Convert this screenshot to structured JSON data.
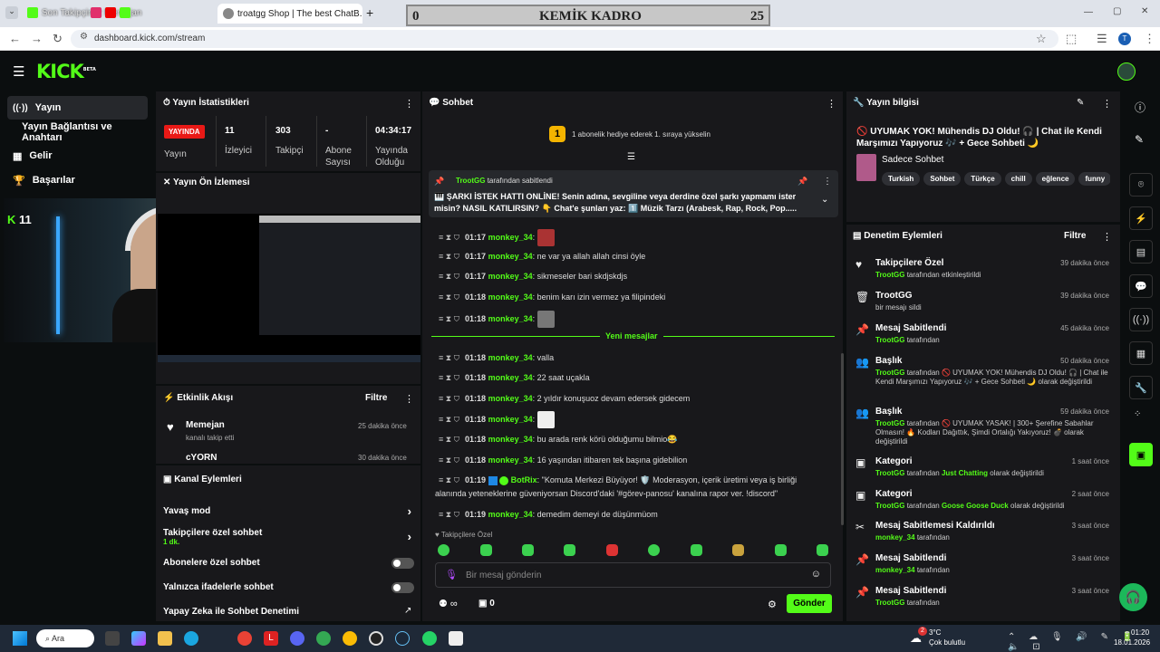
{
  "browser": {
    "tabs": [
      {
        "label": "Son Takipçimiz Memejan",
        "color": "#53fc18"
      },
      {
        "label": "troatgg Shop | The best ChatB...",
        "color": "#888"
      }
    ],
    "new_tab": "+",
    "url": "dashboard.kick.com/stream"
  },
  "scoreboard": {
    "left": "0",
    "title": "KEMİK KADRO",
    "right": "25"
  },
  "kick": {
    "logo": "KICK",
    "beta": "BETA"
  },
  "sidebar": {
    "items": [
      {
        "label": "Yayın",
        "icon": "broadcast-icon"
      },
      {
        "label": "Yayın Bağlantısı ve Anahtarı",
        "icon": ""
      },
      {
        "label": "Gelir",
        "icon": "revenue-icon"
      },
      {
        "label": "Başarılar",
        "icon": "trophy-icon"
      }
    ],
    "overlay_count": "11"
  },
  "stats": {
    "title": "Yayın İstatistikleri",
    "live": "YAYINDA",
    "live_label": "Yayın",
    "items": [
      {
        "value": "11",
        "label": "İzleyici"
      },
      {
        "value": "303",
        "label": "Takipçi"
      },
      {
        "value": "-",
        "label": "Abone Sayısı"
      },
      {
        "value": "04:34:17",
        "label": "Yayında Olduğu"
      }
    ]
  },
  "preview": {
    "title": "Yayın Ön İzlemesi"
  },
  "activity": {
    "title": "Etkinlik Akışı",
    "filter": "Filtre",
    "items": [
      {
        "name": "Memejan",
        "desc": "kanalı takip etti",
        "time": "25 dakika önce"
      },
      {
        "name": "cYORN",
        "desc": "",
        "time": "30 dakika önce"
      }
    ]
  },
  "channel_actions": {
    "title": "Kanal Eylemleri",
    "items": [
      {
        "label": "Yavaş mod",
        "sub": ""
      },
      {
        "label": "Takipçilere özel sohbet",
        "sub": "1 dk."
      },
      {
        "label": "Abonelere özel sohbet",
        "sub": ""
      },
      {
        "label": "Yalnızca ifadelerle sohbet",
        "sub": ""
      },
      {
        "label": "Yapay Zeka ile Sohbet Denetimi",
        "sub": ""
      }
    ]
  },
  "chat": {
    "title": "Sohbet",
    "gift_banner": "1 abonelik hediye ederek 1. sıraya yükselin",
    "gift_rank": "1",
    "pinned": {
      "by": "TrootGG",
      "by_suffix": "tarafından sabitlendi",
      "text": "🎹 ŞARKI İSTEK HATTI ONLİNE! Senin adına, sevgiline veya derdine özel şarkı yapmamı ister misin? NASIL KATILIRSIN? 👇 Chat'e şunları yaz: 1️⃣ Müzik Tarzı (Arabesk, Rap, Rock, Pop....."
    },
    "new_messages": "Yeni mesajlar",
    "messages": [
      {
        "time": "01:17",
        "user": "monkey_34",
        "text": "",
        "emote": true
      },
      {
        "time": "01:17",
        "user": "monkey_34",
        "text": "ne var ya allah allah cinsi öyle"
      },
      {
        "time": "01:17",
        "user": "monkey_34",
        "text": "sikmeseler bari skdjskdjs"
      },
      {
        "time": "01:18",
        "user": "monkey_34",
        "text": "benim karı izin vermez ya filipindeki"
      },
      {
        "time": "01:18",
        "user": "monkey_34",
        "text": "",
        "emote": true
      },
      {
        "time": "01:18",
        "user": "monkey_34",
        "text": "valla"
      },
      {
        "time": "01:18",
        "user": "monkey_34",
        "text": "22 saat uçakla"
      },
      {
        "time": "01:18",
        "user": "monkey_34",
        "text": "2 yıldır konuşuoz devam edersek gidecem"
      },
      {
        "time": "01:18",
        "user": "monkey_34",
        "text": "",
        "emote": true
      },
      {
        "time": "01:18",
        "user": "monkey_34",
        "text": "bu arada renk körü olduğumu bilmio😂"
      },
      {
        "time": "01:18",
        "user": "monkey_34",
        "text": "16 yaşından itibaren tek başına gidebilion"
      },
      {
        "time": "01:19",
        "user": "BotRix",
        "text": "\"Komuta Merkezi Büyüyor! 🛡️ Moderasyon, içerik üretimi veya iş birliği",
        "text2": "alanında yeteneklerine güveniyorsan Discord'daki '#görev-panosu' kanalına rapor ver. !discord\""
      },
      {
        "time": "01:19",
        "user": "monkey_34",
        "text": "demedim demeyi de düşünmüom"
      }
    ],
    "followers_only": "Takipçilere Özel",
    "input_placeholder": "Bir mesaj gönderin",
    "infinity": "∞",
    "count": "0",
    "send": "Gönder"
  },
  "stream_info": {
    "title": "Yayın bilgisi",
    "stream_title": "🚫 UYUMAK YOK! Mühendis DJ Oldu! 🎧 | Chat ile Kendi Marşımızı Yapıyoruz 🎶 + Gece Sohbeti 🌙",
    "category": "Sadece Sohbet",
    "tags": [
      "Turkish",
      "Sohbet",
      "Türkçe",
      "chill",
      "eğlence",
      "funny"
    ]
  },
  "moderation": {
    "title": "Denetim Eylemleri",
    "filter": "Filtre",
    "items": [
      {
        "icon": "heart-icon",
        "title": "Takipçilere Özel",
        "who": "TrootGG",
        "rest": "tarafından etkinleştirildi",
        "time": "39 dakika önce"
      },
      {
        "icon": "trash-icon",
        "title": "TrootGG",
        "who": "",
        "rest": "bir mesajı sildi",
        "time": "39 dakika önce"
      },
      {
        "icon": "pin-icon",
        "title": "Mesaj Sabitlendi",
        "who": "TrootGG",
        "rest": "tarafından",
        "time": "45 dakika önce"
      },
      {
        "icon": "user-edit-icon",
        "title": "Başlık",
        "who": "TrootGG",
        "rest": "tarafından 🚫 UYUMAK YOK! Mühendis DJ Oldu! 🎧 | Chat ile Kendi Marşımızı Yapıyoruz 🎶 + Gece Sohbeti 🌙 olarak değiştirildi",
        "time": "50 dakika önce"
      },
      {
        "icon": "user-edit-icon",
        "title": "Başlık",
        "who": "TrootGG",
        "rest": "tarafından 🚫 UYUMAK YASAK! | 300+ Şerefine Sabahlar Olmasın! 🔥 Kodları Dağıttık, Şimdi Ortalığı Yakıyoruz! 💣 olarak değiştirildi",
        "time": "59 dakika önce"
      },
      {
        "icon": "category-icon",
        "title": "Kategori",
        "who": "TrootGG",
        "rest": "tarafından",
        "hl": "Just Chatting",
        "rest2": "olarak değiştirildi",
        "time": "1 saat önce"
      },
      {
        "icon": "category-icon",
        "title": "Kategori",
        "who": "TrootGG",
        "rest": "tarafından",
        "hl": "Goose Goose Duck",
        "rest2": "olarak değiştirildi",
        "time": "2 saat önce"
      },
      {
        "icon": "unpin-icon",
        "title": "Mesaj Sabitlemesi Kaldırıldı",
        "who": "monkey_34",
        "rest": "tarafından",
        "time": "3 saat önce"
      },
      {
        "icon": "pin-icon",
        "title": "Mesaj Sabitlendi",
        "who": "monkey_34",
        "rest": "tarafından",
        "time": "3 saat önce"
      },
      {
        "icon": "pin-icon",
        "title": "Mesaj Sabitlendi",
        "who": "TrootGG",
        "rest": "tarafından",
        "time": "3 saat önce"
      }
    ]
  },
  "taskbar": {
    "search": "Ara",
    "weather_temp": "3°C",
    "weather_desc": "Çok bulutlu",
    "time": "01:20",
    "date": "18.01.2026",
    "weather_badge": "2"
  },
  "colors": {
    "accent": "#53fc18",
    "live": "#e91916",
    "panel": "#18181b",
    "bg": "#0b0e0f"
  }
}
